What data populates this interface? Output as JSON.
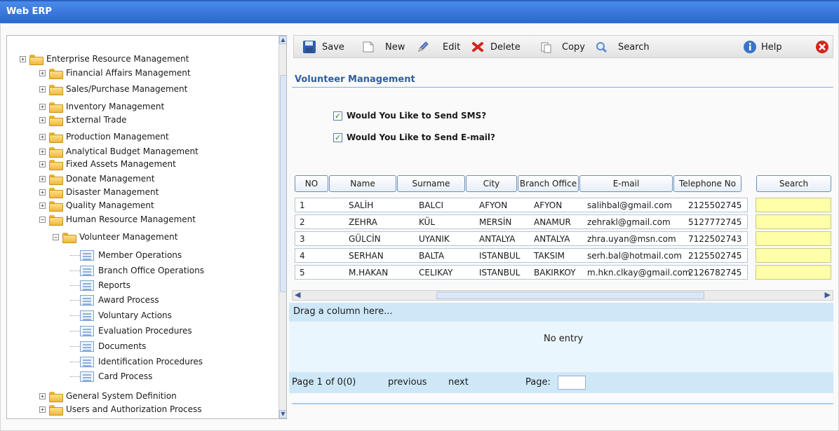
{
  "app": {
    "title": "Web ERP"
  },
  "tree": {
    "root": "Enterprise Resource Management",
    "modules": [
      "Financial Affairs Management",
      "Sales/Purchase Management",
      "Inventory Management",
      "External Trade",
      "Production Management",
      "Analytical Budget Management",
      "Fixed Assets Management",
      "Donate Management",
      "Disaster Management",
      "Quality Management",
      "Human Resource Management"
    ],
    "sub_module": "Volunteer Management",
    "leaves": [
      "Member Operations",
      "Branch Office Operations",
      "Reports",
      "Award Process",
      "Voluntary Actions",
      "Evaluation Procedures",
      "Documents",
      "Identification Procedures",
      "Card Process"
    ],
    "tail": [
      "General System Definition",
      "Users and Authorization Process"
    ]
  },
  "toolbar": {
    "save": "Save",
    "new": "New",
    "edit": "Edit",
    "delete": "Delete",
    "copy": "Copy",
    "search": "Search",
    "help": "Help"
  },
  "section": {
    "title": "Volunteer Management"
  },
  "options": {
    "sms": {
      "label": "Would You Like to Send SMS?",
      "checked": true
    },
    "email": {
      "label": "Would You Like to Send E-mail?",
      "checked": true
    }
  },
  "grid": {
    "columns": [
      "NO",
      "Name",
      "Surname",
      "City",
      "Branch Office",
      "E-mail",
      "Telephone No"
    ],
    "search_header": "Search",
    "rows": [
      [
        "1",
        "SALİH",
        "BALCI",
        "AFYON",
        "AFYON",
        "salihbal@gmail.com",
        "2125502745"
      ],
      [
        "2",
        "ZEHRA",
        "KÜL",
        "MERSİN",
        "ANAMUR",
        "zehrakl@gmail.com",
        "5127772745"
      ],
      [
        "3",
        "GÜLCİN",
        "UYANIK",
        "ANTALYA",
        "ANTALYA",
        "zhra.uyan@msn.com",
        "7122502743"
      ],
      [
        "4",
        "SERHAN",
        "BALTA",
        "ISTANBUL",
        "TAKSIM",
        "serh.bal@hotmail.com",
        "2125502745"
      ],
      [
        "5",
        "M.HAKAN",
        "CELIKAY",
        "ISTANBUL",
        "BAKIRKOY",
        "m.hkn.clkay@gmail.com",
        "2126782745"
      ]
    ],
    "drag_hint": "Drag a column here...",
    "empty_text": "No entry"
  },
  "pager": {
    "info": "Page 1 of 0(0)",
    "previous": "previous",
    "next": "next",
    "page_label": "Page:"
  }
}
